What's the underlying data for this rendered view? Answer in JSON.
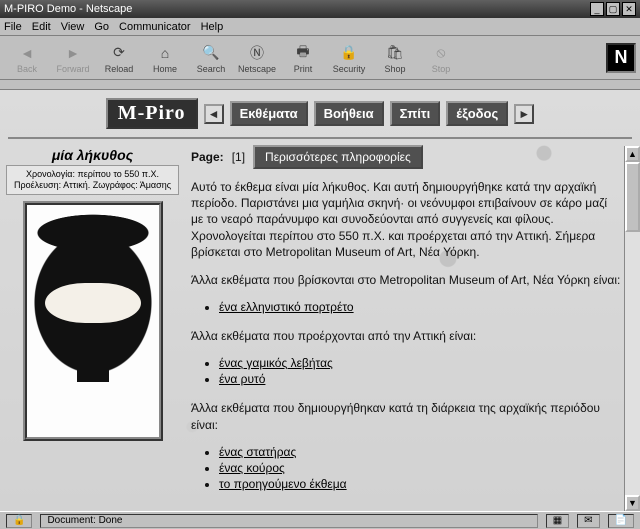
{
  "window": {
    "title": "M-PIRO Demo - Netscape",
    "controls": {
      "min": "_",
      "max": "▢",
      "close": "✕"
    }
  },
  "menu": [
    "File",
    "Edit",
    "View",
    "Go",
    "Communicator",
    "Help"
  ],
  "toolbar": [
    {
      "name": "back",
      "label": "Back",
      "glyph": "◄",
      "dim": true
    },
    {
      "name": "forward",
      "label": "Forward",
      "glyph": "►",
      "dim": true
    },
    {
      "name": "reload",
      "label": "Reload",
      "glyph": "⟳",
      "dim": false
    },
    {
      "name": "home",
      "label": "Home",
      "glyph": "⌂",
      "dim": false
    },
    {
      "name": "search",
      "label": "Search",
      "glyph": "🔍",
      "dim": false
    },
    {
      "name": "netscape",
      "label": "Netscape",
      "glyph": "Ⓝ",
      "dim": false
    },
    {
      "name": "print",
      "label": "Print",
      "glyph": "🖶",
      "dim": false
    },
    {
      "name": "security",
      "label": "Security",
      "glyph": "🔒",
      "dim": false
    },
    {
      "name": "shop",
      "label": "Shop",
      "glyph": "🛍",
      "dim": false
    },
    {
      "name": "stop",
      "label": "Stop",
      "glyph": "⦸",
      "dim": true
    }
  ],
  "brand_logo_letter": "N",
  "appnav": {
    "logo": "M-Piro",
    "arrow_prev": "◄",
    "arrow_next": "►",
    "buttons": [
      {
        "name": "ekthemata",
        "label": "Εκθέματα"
      },
      {
        "name": "voitheia",
        "label": "Βοήθεια"
      },
      {
        "name": "spiti",
        "label": "Σπίτι"
      },
      {
        "name": "exodos",
        "label": "έξοδος"
      }
    ]
  },
  "object": {
    "title": "μία λήκυθος",
    "meta": "Χρονολογία: περίπου το 550 π.Χ. Προέλευση: Αττική. Ζωγράφος: Άμασης"
  },
  "page": {
    "label": "Page:",
    "number": "[1]",
    "more_button": "Περισσότερες πληροφορίες"
  },
  "body": {
    "p1": "Αυτό το έκθεμα είναι μία λήκυθος. Και αυτή δημιουργήθηκε κατά την αρχαϊκή περίοδο. Παριστάνει μια γαμήλια σκηνή· οι νεόνυμφοι επιβαίνουν σε κάρο μαζί με το νεαρό παράνυμφο και συνοδεύονται από συγγενείς και φίλους. Χρονολογείται περίπου στο 550 π.Χ. και προέρχεται από την Αττική. Σήμερα βρίσκεται στο Metropolitan Museum of Art, Νέα Υόρκη.",
    "p2": "Άλλα εκθέματα που βρίσκονται στο Metropolitan Museum of Art, Νέα Υόρκη είναι:",
    "list1": [
      "ένα ελληνιστικό πορτρέτο"
    ],
    "p3": "Άλλα εκθέματα που προέρχονται από την Αττική είναι:",
    "list2": [
      "ένας γαμικός λεβήτας",
      "ένα ρυτό"
    ],
    "p4": "Άλλα εκθέματα που δημιουργήθηκαν κατά τη διάρκεια της αρχαϊκής περιόδου είναι:",
    "list3": [
      "ένας στατήρας",
      "ένας κούρος",
      "το προηγούμενο έκθεμα"
    ]
  },
  "status": {
    "text": "Document: Done"
  }
}
